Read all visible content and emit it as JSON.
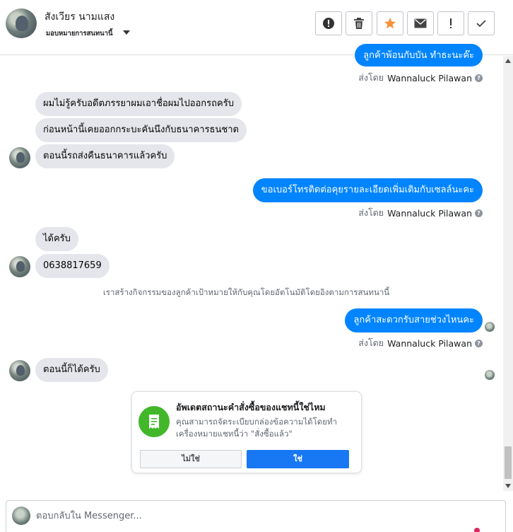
{
  "header": {
    "contact_name": "สังเวียร นามแสง",
    "assign_label": "มอบหมายการสนทนานี้",
    "actions": [
      {
        "name": "mark-spam-button",
        "icon": "alert-circle-icon"
      },
      {
        "name": "delete-button",
        "icon": "trash-icon"
      },
      {
        "name": "star-button",
        "icon": "star-icon"
      },
      {
        "name": "mark-unread-button",
        "icon": "envelope-icon"
      },
      {
        "name": "follow-up-button",
        "icon": "exclamation-icon"
      },
      {
        "name": "mark-done-button",
        "icon": "checkmark-icon"
      }
    ]
  },
  "messages": {
    "top_partial": "ลูกค้าพ้อนกับบัน ทำธะนะค๊ะ",
    "in_1": "ผมไม่รู้ครับอดีตภรรยาผมเอาชื่อผมไปออกรถครับ",
    "in_2": "ก่อนหน้านี้เคยออกกระบะคันนึงกับธนาคารธนชาต",
    "in_3": "ตอนนี้รถส่งคืนธนาคารแล้วครับ",
    "out_1": "ขอเบอร์โทรติดต่อคุยรายละเอียดเพิ่มเติมกับเซลล์นะคะ",
    "in_4": "ได้ครับ",
    "in_5": "0638817659",
    "system_note": "เราสร้างกิจกรรมของลูกค้าเป้าหมายให้กับคุณโดยอัตโนมัติโดยอิงตามการสนทนานี้",
    "out_2": "ลูกค้าสะดวกรับสายช่วงไหนคะ",
    "in_6": "ตอนนี้ก็ได้ครับ"
  },
  "sent_by": {
    "prefix": "ส่งโดย",
    "agent": "Wannaluck Pilawan",
    "info_icon": "?"
  },
  "order_prompt": {
    "icon": "receipt-icon",
    "title": "อัพเดตสถานะคำสั่งซื้อของแชทนี้ใช่ไหม",
    "body": "คุณสามารถจัดระเบียบกล่องข้อความได้โดยทำเครื่องหมายแชทนี้ว่า \"สั่งซื้อแล้ว\"",
    "no_label": "ไม่ใช่",
    "yes_label": "ใช่"
  },
  "composer": {
    "placeholder": "ตอบกลับใน Messenger..."
  },
  "colors": {
    "outgoing_bubble": "#0084ff",
    "incoming_bubble": "#e4e6eb",
    "primary_button": "#1877f2",
    "order_icon_bg": "#42b72a",
    "star": "#f7923b"
  }
}
